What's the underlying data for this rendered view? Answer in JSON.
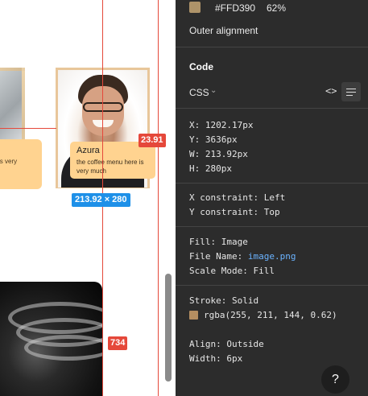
{
  "canvas": {
    "left_card_text": "is very",
    "card": {
      "name": "Azura",
      "text": "the coffee menu here is very much"
    },
    "measure_spacing": "23.91",
    "measure_size": "213.92 × 280",
    "measure_bottom": "734"
  },
  "inspector": {
    "fill_hex": "#FFD390",
    "fill_opacity": "62%",
    "outer_alignment": "Outer alignment",
    "code_title": "Code",
    "language": "CSS",
    "position": {
      "x": "X: 1202.17px",
      "y": "Y: 3636px",
      "w": "W: 213.92px",
      "h": "H: 280px"
    },
    "constraints": {
      "x": "X constraint: Left",
      "y": "Y constraint: Top"
    },
    "fill": {
      "type": "Fill: Image",
      "file_name_label": "File Name: ",
      "file_name": "image.png",
      "scale_mode": "Scale Mode: Fill"
    },
    "stroke": {
      "type": "Stroke: Solid",
      "color": "rgba(255, 211, 144, 0.62)",
      "swatch_hex": "#b48e61",
      "align": "Align: Outside",
      "width": "Width: 6px"
    },
    "help": "?"
  },
  "icons": [
    "chevron-down-icon",
    "code-icon",
    "list-icon",
    "help-icon"
  ],
  "colors": {
    "guide": "#e5483a",
    "size_badge": "#1e90e8",
    "bubble": "#ffd390",
    "panel_bg": "#2c2c2c"
  }
}
